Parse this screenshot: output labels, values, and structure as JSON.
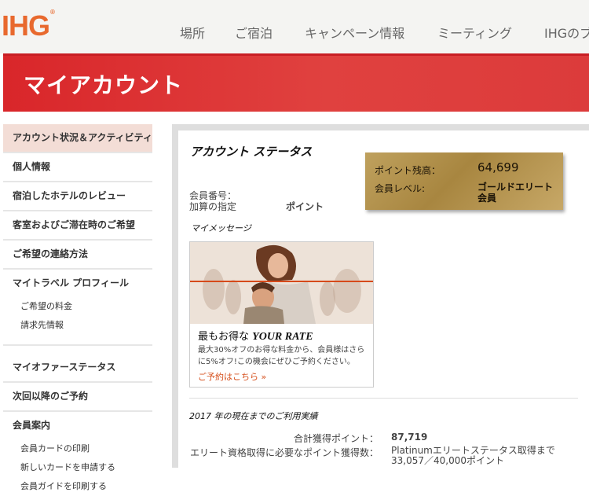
{
  "header": {
    "logo": "IHG",
    "logo_mark": "®",
    "nav": [
      "場所",
      "ご宿泊",
      "キャンペーン情報",
      "ミーティング",
      "IHGのブ"
    ]
  },
  "banner": {
    "title": "マイアカウント"
  },
  "sidebar": {
    "items": [
      {
        "label": "アカウント状況＆アクティビティ",
        "active": true
      },
      {
        "label": "個人情報"
      },
      {
        "label": "宿泊したホテルのレビュー"
      },
      {
        "label": "客室およびご滞在時のご希望"
      },
      {
        "label": "ご希望の連絡方法"
      },
      {
        "label": "マイトラベル プロフィール"
      }
    ],
    "travel_sub": [
      "ご希望の料金",
      "請求先情報"
    ],
    "items2": [
      {
        "label": "マイオファーステータス"
      },
      {
        "label": "次回以降のご予約"
      },
      {
        "label": "会員案内"
      }
    ],
    "member_sub": [
      "会員カードの印刷",
      "新しいカードを申請する",
      "会員ガイドを印刷する"
    ]
  },
  "account": {
    "title": "アカウント ステータス",
    "member_number_label": "会員番号：",
    "accrual_label": "加算の指定",
    "accrual_value": "ポイント",
    "points_label": "ポイント残高：",
    "points_value": "64,699",
    "level_label": "会員レベル:",
    "level_value": "ゴールドエリート会員"
  },
  "messages": {
    "title": "マイメッセージ",
    "promo_heading_prefix": "最もお得な",
    "promo_heading_brand": "YOUR RATE",
    "promo_body": "最大30%オフのお得な料金から、会員様はさらに5%オフ!この機会にぜひご予約ください。",
    "promo_cta": "ご予約はこちら »"
  },
  "year_summary": {
    "title": "2017 年の現在までのご利用実績",
    "rows": [
      {
        "label": "合計獲得ポイント：",
        "value": "87,719"
      },
      {
        "label": "エリート資格取得に必要なポイント獲得数：",
        "value": "Platinumエリートステータス取得まで 33,057／40,000ポイント"
      }
    ]
  },
  "colors": {
    "brand_orange": "#e8692e",
    "banner_red": "#d9262a",
    "gold": "#b39250",
    "active_bg": "#f3ddd6"
  }
}
